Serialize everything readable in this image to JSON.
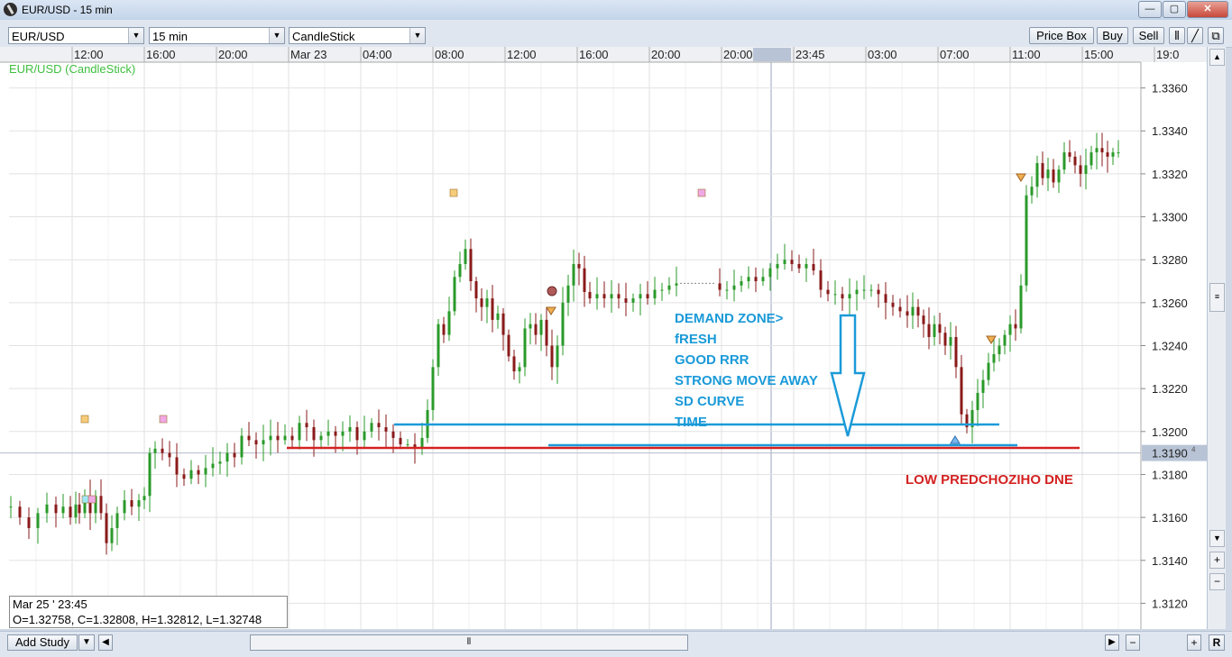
{
  "window": {
    "title": "EUR/USD - 15 min",
    "minimize": "—",
    "maximize": "▢",
    "close": "✕"
  },
  "toolbar": {
    "symbol": "EUR/USD",
    "interval": "15 min",
    "chart_style": "CandleStick",
    "price_box": "Price Box",
    "buy": "Buy",
    "sell": "Sell"
  },
  "chart_data": {
    "type": "candlestick",
    "title": "EUR/USD (CandleStick)",
    "x_tick_labels": [
      "12:00",
      "16:00",
      "20:00",
      "Mar 23",
      "04:00",
      "08:00",
      "12:00",
      "16:00",
      "20:00",
      "20:00",
      "23:45",
      "03:00",
      "07:00",
      "11:00",
      "15:00",
      "19:0"
    ],
    "y_tick_labels": [
      "1.3360",
      "1.3340",
      "1.3320",
      "1.3300",
      "1.3280",
      "1.3260",
      "1.3240",
      "1.3220",
      "1.3200",
      "1.3190",
      "1.3180",
      "1.3160",
      "1.3140",
      "1.3120"
    ],
    "ylim": [
      1.3108,
      1.3372
    ],
    "current_price_label": "1.3190",
    "current_price_superscript": "4",
    "crosshair_time_label": "23:45",
    "grid": true,
    "price_path": [
      {
        "t": 0,
        "p": 1.3165
      },
      {
        "t": 10,
        "p": 1.316
      },
      {
        "t": 20,
        "p": 1.3155
      },
      {
        "t": 30,
        "p": 1.3162
      },
      {
        "t": 40,
        "p": 1.3166
      },
      {
        "t": 50,
        "p": 1.3162
      },
      {
        "t": 58,
        "p": 1.3165
      },
      {
        "t": 66,
        "p": 1.316
      },
      {
        "t": 72,
        "p": 1.3166
      },
      {
        "t": 76,
        "p": 1.3162
      },
      {
        "t": 82,
        "p": 1.317
      },
      {
        "t": 88,
        "p": 1.3162
      },
      {
        "t": 94,
        "p": 1.317
      },
      {
        "t": 100,
        "p": 1.3162
      },
      {
        "t": 106,
        "p": 1.3148
      },
      {
        "t": 112,
        "p": 1.3155
      },
      {
        "t": 118,
        "p": 1.3162
      },
      {
        "t": 126,
        "p": 1.3168
      },
      {
        "t": 134,
        "p": 1.3165
      },
      {
        "t": 142,
        "p": 1.3168
      },
      {
        "t": 148,
        "p": 1.317
      },
      {
        "t": 154,
        "p": 1.319
      },
      {
        "t": 160,
        "p": 1.3192
      },
      {
        "t": 168,
        "p": 1.319
      },
      {
        "t": 176,
        "p": 1.3188
      },
      {
        "t": 184,
        "p": 1.318
      },
      {
        "t": 192,
        "p": 1.3178
      },
      {
        "t": 200,
        "p": 1.3182
      },
      {
        "t": 208,
        "p": 1.318
      },
      {
        "t": 216,
        "p": 1.3183
      },
      {
        "t": 224,
        "p": 1.3185
      },
      {
        "t": 232,
        "p": 1.3186
      },
      {
        "t": 240,
        "p": 1.319
      },
      {
        "t": 248,
        "p": 1.3188
      },
      {
        "t": 256,
        "p": 1.3198
      },
      {
        "t": 264,
        "p": 1.3196
      },
      {
        "t": 272,
        "p": 1.3194
      },
      {
        "t": 280,
        "p": 1.3196
      },
      {
        "t": 288,
        "p": 1.3198
      },
      {
        "t": 296,
        "p": 1.3196
      },
      {
        "t": 304,
        "p": 1.3198
      },
      {
        "t": 312,
        "p": 1.3196
      },
      {
        "t": 320,
        "p": 1.3204
      },
      {
        "t": 328,
        "p": 1.3202
      },
      {
        "t": 336,
        "p": 1.3196
      },
      {
        "t": 344,
        "p": 1.3198
      },
      {
        "t": 352,
        "p": 1.32
      },
      {
        "t": 360,
        "p": 1.3198
      },
      {
        "t": 368,
        "p": 1.32
      },
      {
        "t": 376,
        "p": 1.3202
      },
      {
        "t": 384,
        "p": 1.3196
      },
      {
        "t": 392,
        "p": 1.32
      },
      {
        "t": 400,
        "p": 1.3204
      },
      {
        "t": 408,
        "p": 1.3202
      },
      {
        "t": 416,
        "p": 1.32
      },
      {
        "t": 424,
        "p": 1.3197
      },
      {
        "t": 432,
        "p": 1.3194
      },
      {
        "t": 440,
        "p": 1.3194
      },
      {
        "t": 448,
        "p": 1.3192
      },
      {
        "t": 456,
        "p": 1.3197
      },
      {
        "t": 462,
        "p": 1.321
      },
      {
        "t": 468,
        "p": 1.323
      },
      {
        "t": 474,
        "p": 1.325
      },
      {
        "t": 480,
        "p": 1.3245
      },
      {
        "t": 486,
        "p": 1.3256
      },
      {
        "t": 492,
        "p": 1.3272
      },
      {
        "t": 498,
        "p": 1.3278
      },
      {
        "t": 504,
        "p": 1.3285
      },
      {
        "t": 510,
        "p": 1.327
      },
      {
        "t": 516,
        "p": 1.3262
      },
      {
        "t": 522,
        "p": 1.3258
      },
      {
        "t": 528,
        "p": 1.3262
      },
      {
        "t": 534,
        "p": 1.3252
      },
      {
        "t": 540,
        "p": 1.3255
      },
      {
        "t": 546,
        "p": 1.3245
      },
      {
        "t": 552,
        "p": 1.3235
      },
      {
        "t": 558,
        "p": 1.3228
      },
      {
        "t": 564,
        "p": 1.323
      },
      {
        "t": 570,
        "p": 1.3248
      },
      {
        "t": 576,
        "p": 1.325
      },
      {
        "t": 582,
        "p": 1.3245
      },
      {
        "t": 588,
        "p": 1.3252
      },
      {
        "t": 594,
        "p": 1.324
      },
      {
        "t": 600,
        "p": 1.323
      },
      {
        "t": 606,
        "p": 1.324
      },
      {
        "t": 612,
        "p": 1.326
      },
      {
        "t": 618,
        "p": 1.3268
      },
      {
        "t": 624,
        "p": 1.3278
      },
      {
        "t": 630,
        "p": 1.3276
      },
      {
        "t": 636,
        "p": 1.3265
      },
      {
        "t": 642,
        "p": 1.3262
      },
      {
        "t": 650,
        "p": 1.3264
      },
      {
        "t": 658,
        "p": 1.3262
      },
      {
        "t": 666,
        "p": 1.3264
      },
      {
        "t": 674,
        "p": 1.3262
      },
      {
        "t": 682,
        "p": 1.326
      },
      {
        "t": 690,
        "p": 1.3262
      },
      {
        "t": 698,
        "p": 1.3264
      },
      {
        "t": 706,
        "p": 1.3262
      },
      {
        "t": 714,
        "p": 1.3266
      },
      {
        "t": 722,
        "p": 1.3266
      },
      {
        "t": 730,
        "p": 1.3268
      },
      {
        "t": 738,
        "p": 1.3269
      },
      {
        "t": 746,
        "p": 1.3269
      },
      {
        "t": 754,
        "p": 1.3269
      },
      {
        "t": 762,
        "p": 1.3269
      },
      {
        "t": 770,
        "p": 1.3269
      },
      {
        "t": 778,
        "p": 1.3269
      },
      {
        "t": 786,
        "p": 1.3266
      },
      {
        "t": 794,
        "p": 1.3266
      },
      {
        "t": 802,
        "p": 1.3268
      },
      {
        "t": 810,
        "p": 1.327
      },
      {
        "t": 818,
        "p": 1.3272
      },
      {
        "t": 826,
        "p": 1.327
      },
      {
        "t": 834,
        "p": 1.3272
      },
      {
        "t": 842,
        "p": 1.3276
      },
      {
        "t": 850,
        "p": 1.3278
      },
      {
        "t": 858,
        "p": 1.328
      },
      {
        "t": 866,
        "p": 1.3278
      },
      {
        "t": 874,
        "p": 1.3276
      },
      {
        "t": 882,
        "p": 1.3278
      },
      {
        "t": 890,
        "p": 1.3275
      },
      {
        "t": 898,
        "p": 1.3266
      },
      {
        "t": 906,
        "p": 1.3264
      },
      {
        "t": 914,
        "p": 1.3264
      },
      {
        "t": 922,
        "p": 1.3262
      },
      {
        "t": 930,
        "p": 1.3264
      },
      {
        "t": 938,
        "p": 1.3266
      },
      {
        "t": 946,
        "p": 1.3266
      },
      {
        "t": 954,
        "p": 1.3266
      },
      {
        "t": 962,
        "p": 1.3264
      },
      {
        "t": 970,
        "p": 1.326
      },
      {
        "t": 978,
        "p": 1.3258
      },
      {
        "t": 986,
        "p": 1.3256
      },
      {
        "t": 994,
        "p": 1.3254
      },
      {
        "t": 1000,
        "p": 1.3258
      },
      {
        "t": 1006,
        "p": 1.3254
      },
      {
        "t": 1012,
        "p": 1.325
      },
      {
        "t": 1018,
        "p": 1.3244
      },
      {
        "t": 1024,
        "p": 1.325
      },
      {
        "t": 1030,
        "p": 1.3246
      },
      {
        "t": 1036,
        "p": 1.324
      },
      {
        "t": 1042,
        "p": 1.3244
      },
      {
        "t": 1048,
        "p": 1.323
      },
      {
        "t": 1054,
        "p": 1.3208
      },
      {
        "t": 1060,
        "p": 1.3202
      },
      {
        "t": 1066,
        "p": 1.321
      },
      {
        "t": 1072,
        "p": 1.3218
      },
      {
        "t": 1078,
        "p": 1.3224
      },
      {
        "t": 1084,
        "p": 1.3232
      },
      {
        "t": 1090,
        "p": 1.3236
      },
      {
        "t": 1096,
        "p": 1.324
      },
      {
        "t": 1102,
        "p": 1.3245
      },
      {
        "t": 1108,
        "p": 1.325
      },
      {
        "t": 1114,
        "p": 1.3248
      },
      {
        "t": 1120,
        "p": 1.3268
      },
      {
        "t": 1126,
        "p": 1.331
      },
      {
        "t": 1132,
        "p": 1.3314
      },
      {
        "t": 1138,
        "p": 1.3325
      },
      {
        "t": 1144,
        "p": 1.3318
      },
      {
        "t": 1150,
        "p": 1.3322
      },
      {
        "t": 1156,
        "p": 1.3316
      },
      {
        "t": 1162,
        "p": 1.3322
      },
      {
        "t": 1168,
        "p": 1.333
      },
      {
        "t": 1174,
        "p": 1.3328
      },
      {
        "t": 1180,
        "p": 1.3324
      },
      {
        "t": 1186,
        "p": 1.332
      },
      {
        "t": 1192,
        "p": 1.3324
      },
      {
        "t": 1198,
        "p": 1.333
      },
      {
        "t": 1204,
        "p": 1.3332
      },
      {
        "t": 1210,
        "p": 1.333
      },
      {
        "t": 1216,
        "p": 1.3328
      },
      {
        "t": 1222,
        "p": 1.333
      },
      {
        "t": 1228,
        "p": 1.333
      }
    ],
    "annotations": [
      {
        "text": "DEMAND ZONE>",
        "color": "#1a9ad8"
      },
      {
        "text": "fRESH",
        "color": "#1a9ad8"
      },
      {
        "text": "GOOD RRR",
        "color": "#1a9ad8"
      },
      {
        "text": "STRONG MOVE AWAY",
        "color": "#1a9ad8"
      },
      {
        "text": "SD CURVE",
        "color": "#1a9ad8"
      },
      {
        "text": "TIME",
        "color": "#1a9ad8"
      },
      {
        "text": "LOW PREDCHOZIHO DNE",
        "color": "#d42222"
      }
    ],
    "zone_lines": [
      {
        "price": 1.32,
        "color": "#1a9ad8"
      },
      {
        "price": 1.31905,
        "color": "#1a9ad8"
      },
      {
        "price": 1.3189,
        "color": "#d42222"
      }
    ],
    "colors": {
      "up": "#2a9a2a",
      "down": "#8a1a1a",
      "title": "#3fbf3f",
      "background": "#ffffff",
      "grid": "#e2e2e2"
    }
  },
  "info": {
    "date": "Mar 25 ' 23:45",
    "ohlc": "O=1.32758, C=1.32808, H=1.32812, L=1.32748"
  },
  "bottom": {
    "add_study": "Add Study",
    "r_button": "R"
  }
}
